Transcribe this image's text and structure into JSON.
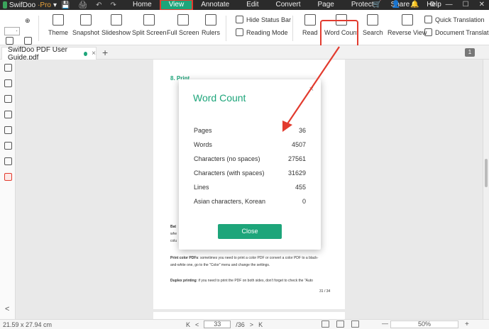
{
  "app": {
    "name": "SwifDoo",
    "pro": "·Pro",
    "dropdown": "▾"
  },
  "quick_access": [
    "💾",
    "🖨",
    "↶",
    "↷"
  ],
  "menu": [
    "Home",
    "View",
    "Annotate",
    "Edit",
    "Convert",
    "Page",
    "Protect",
    "Share",
    "Help"
  ],
  "menu_active": "View",
  "window_controls": {
    "cart": "🛒",
    "user": "👤",
    "bell": "🔔",
    "settings": "⚙",
    "minimize": "—",
    "maximize": "☐",
    "close": "✕"
  },
  "zoom_field": {
    "value": "·"
  },
  "ribbon": {
    "theme": "Theme",
    "snapshot": "Snapshot",
    "slideshow": "Slideshow",
    "split_screen": "Split Screen",
    "full_screen": "Full Screen",
    "rulers": "Rulers",
    "hide_status_bar": "Hide Status Bar",
    "reading_mode": "Reading Mode",
    "read": "Read",
    "word_count": "Word Count",
    "search": "Search",
    "reverse_view": "Reverse View",
    "quick_translation": "Quick Translation",
    "document_translate": "Document Translat"
  },
  "tab": {
    "title": "SwifDoo PDF User Guide.pdf",
    "close": "×",
    "new": "+",
    "page_badge": "1"
  },
  "document": {
    "heading": "8. Print",
    "line_bat": "Bat",
    "line_whe": "whe",
    "line_colu": "colu",
    "print_color_label": "Print color PDFs",
    "print_color_text": ": sometimes you need to print a color PDF or convert a color PDF to a black-",
    "print_color_text2": "and-white one, go to the \"Color\" menu and change the settings.",
    "duplex_label": "Duplex printing",
    "duplex_text": ": if you need to print the PDF on both sides, don't forget to check the \"Auto",
    "page_footer": "31 / 34"
  },
  "dialog": {
    "title": "Word Count",
    "close": "×",
    "rows": [
      {
        "label": "Pages",
        "value": "36"
      },
      {
        "label": "Words",
        "value": "4507"
      },
      {
        "label": "Characters (no spaces)",
        "value": "27561"
      },
      {
        "label": "Characters (with spaces)",
        "value": "31629"
      },
      {
        "label": "Lines",
        "value": "455"
      },
      {
        "label": "Asian characters, Korean",
        "value": "0"
      }
    ],
    "button": "Close"
  },
  "statusbar": {
    "dimensions": "21.59 x 27.94 cm",
    "first": "K",
    "prev": "<",
    "current_page": "33",
    "total_pages": "/36",
    "next": ">",
    "last": "K",
    "zoom": "50%",
    "zoom_out": "—",
    "zoom_in": "+"
  },
  "colors": {
    "accent": "#1da57a",
    "highlight": "#e23b2e",
    "titlebar": "#2b2b2b"
  }
}
